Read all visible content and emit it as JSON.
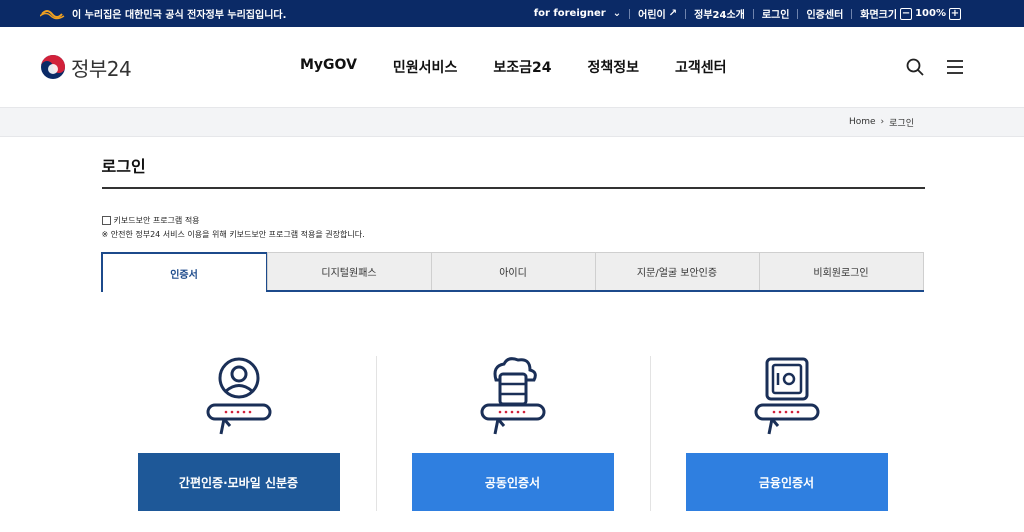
{
  "gov_bar": {
    "notice": "이 누리집은 대한민국 공식 전자정부 누리집입니다.",
    "links": [
      "for foreigner",
      "어린이",
      "정부24소개",
      "로그인",
      "인증센터",
      "화면크기"
    ],
    "zoom_value": "100%",
    "zoom_minus": "−",
    "zoom_plus": "+"
  },
  "header": {
    "brand": "정부24",
    "nav": [
      "MyGOV",
      "민원서비스",
      "보조금24",
      "정책정보",
      "고객센터"
    ],
    "icons": [
      "search-icon",
      "menu-icon"
    ]
  },
  "breadcrumb": {
    "home": "Home",
    "current": "로그인"
  },
  "page": {
    "title": "로그인",
    "keyboard_security_label": "키보드보안 프로그램 적용",
    "keyboard_security_checked": false,
    "notice": "※ 안전한 정부24 서비스 이용을 위해 키보드보안 프로그램 적용을 권장합니다."
  },
  "tabs": [
    "인증서",
    "디지털원패스",
    "아이디",
    "지문/얼굴 보안인증",
    "비회원로그인"
  ],
  "active_tab": "인증서",
  "methods": [
    {
      "label": "간편인증·모바일 신분증",
      "icon": "person-id-icon"
    },
    {
      "label": "공동인증서",
      "icon": "cloud-server-icon"
    },
    {
      "label": "금융인증서",
      "icon": "safe-icon"
    }
  ],
  "colors": {
    "top_bar": "#0b2a66",
    "accent": "#1c4a8b",
    "button": "#2f7fe0",
    "button_dark": "#1e5898"
  }
}
